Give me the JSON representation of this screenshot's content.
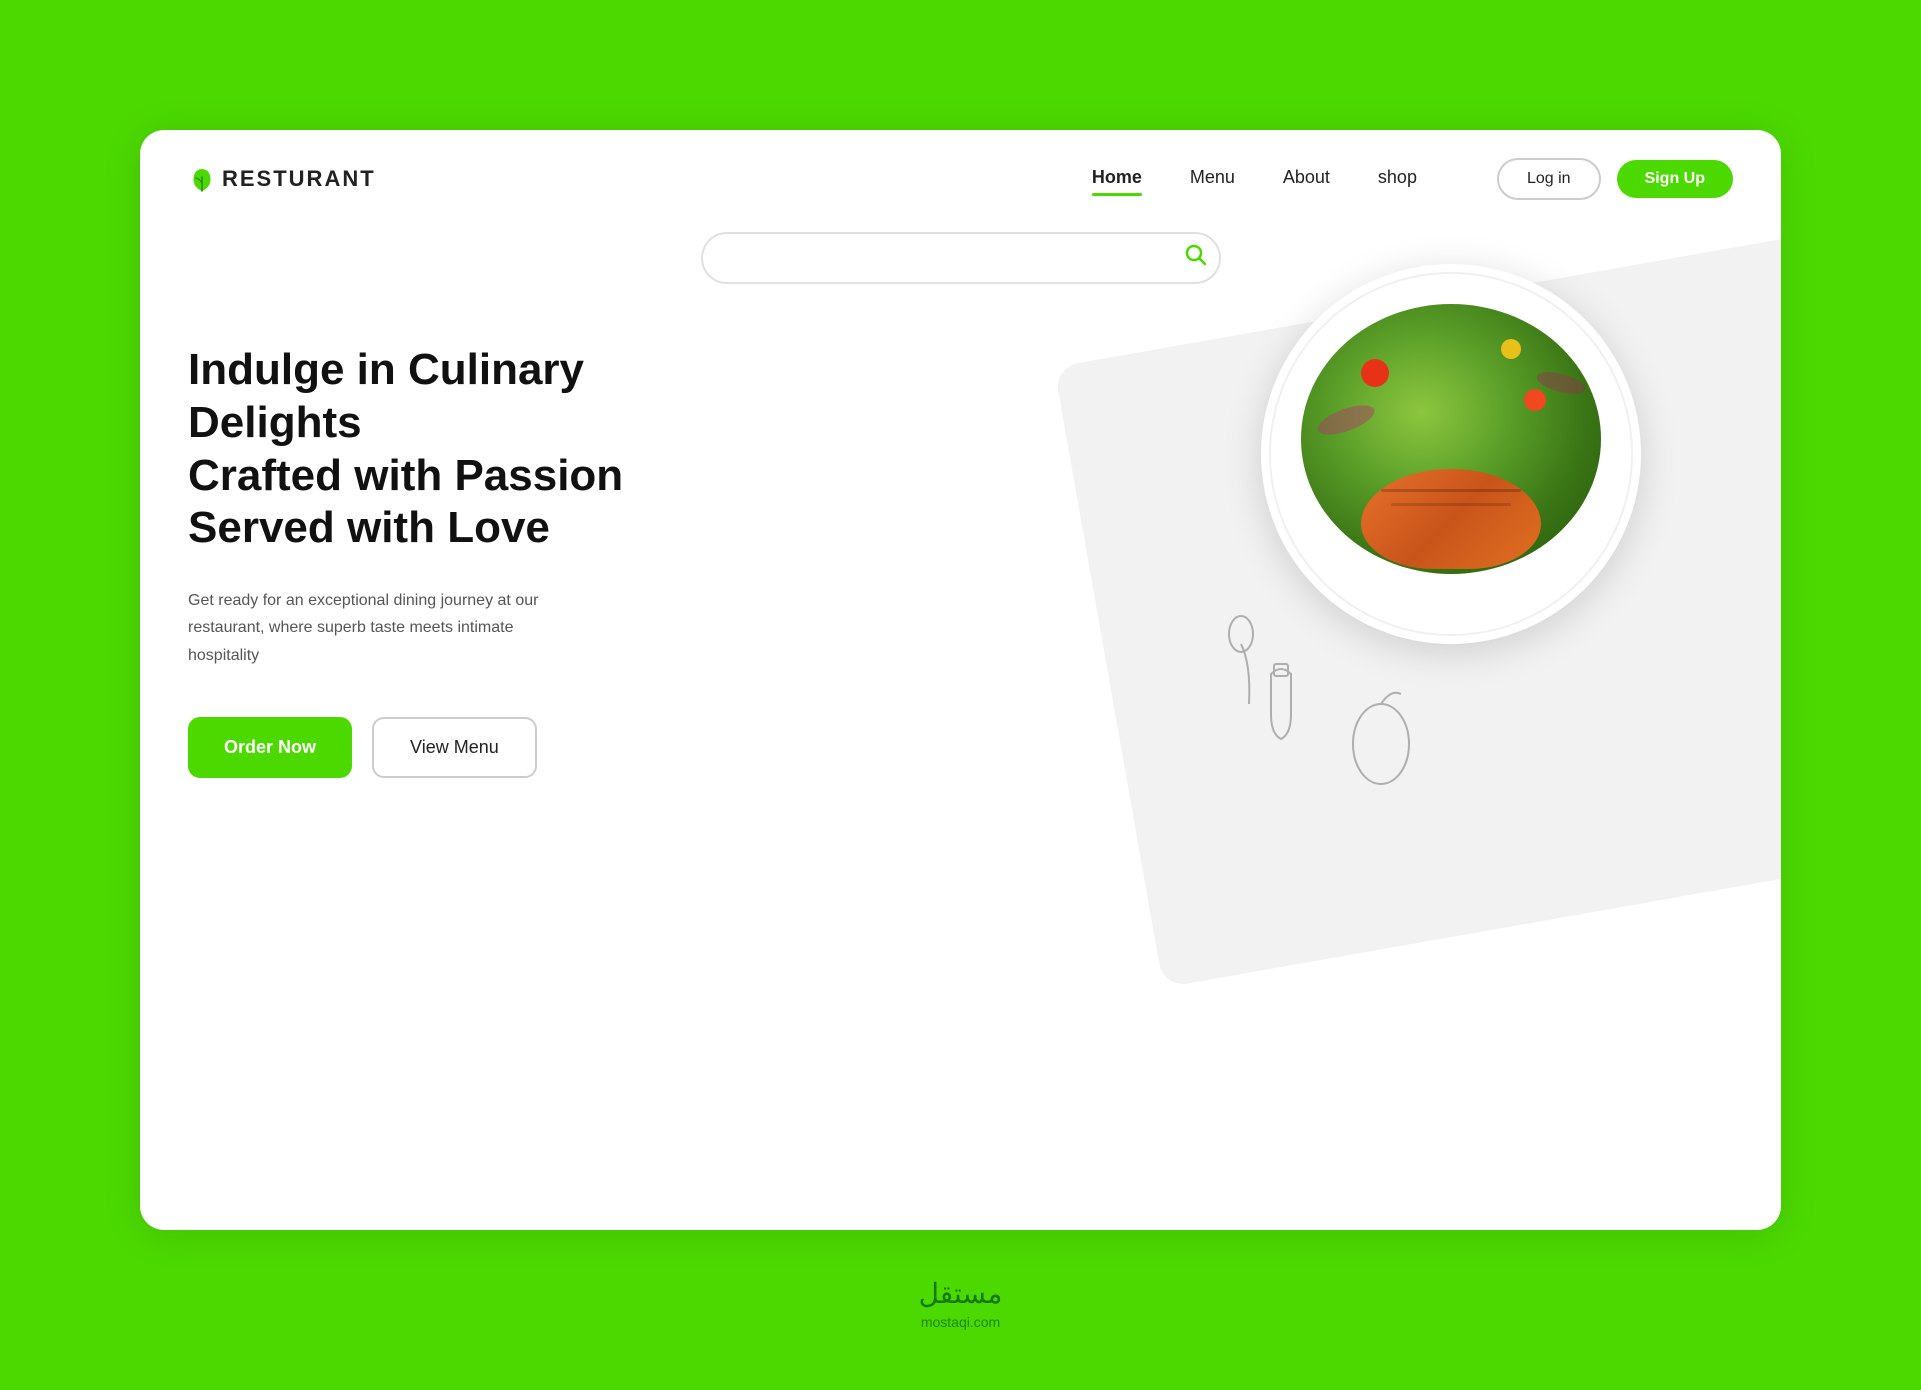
{
  "page": {
    "background_color": "#4cd900"
  },
  "logo": {
    "text": "RESTURANT",
    "icon": "🍃"
  },
  "navbar": {
    "links": [
      {
        "label": "Home",
        "active": true
      },
      {
        "label": "Menu",
        "active": false
      },
      {
        "label": "About",
        "active": false
      },
      {
        "label": "shop",
        "active": false
      }
    ],
    "login_label": "Log in",
    "signup_label": "Sign Up"
  },
  "search": {
    "placeholder": ""
  },
  "hero": {
    "title_line1": "Indulge in Culinary Delights",
    "title_line2": "Crafted with Passion",
    "title_line3": "Served with Love",
    "description": "Get ready for an exceptional dining journey at our restaurant, where superb taste meets intimate hospitality",
    "order_button": "Order Now",
    "menu_button": "View Menu"
  },
  "footer": {
    "arabic_text": "مستقل",
    "site_url": "mostaqi.com"
  }
}
